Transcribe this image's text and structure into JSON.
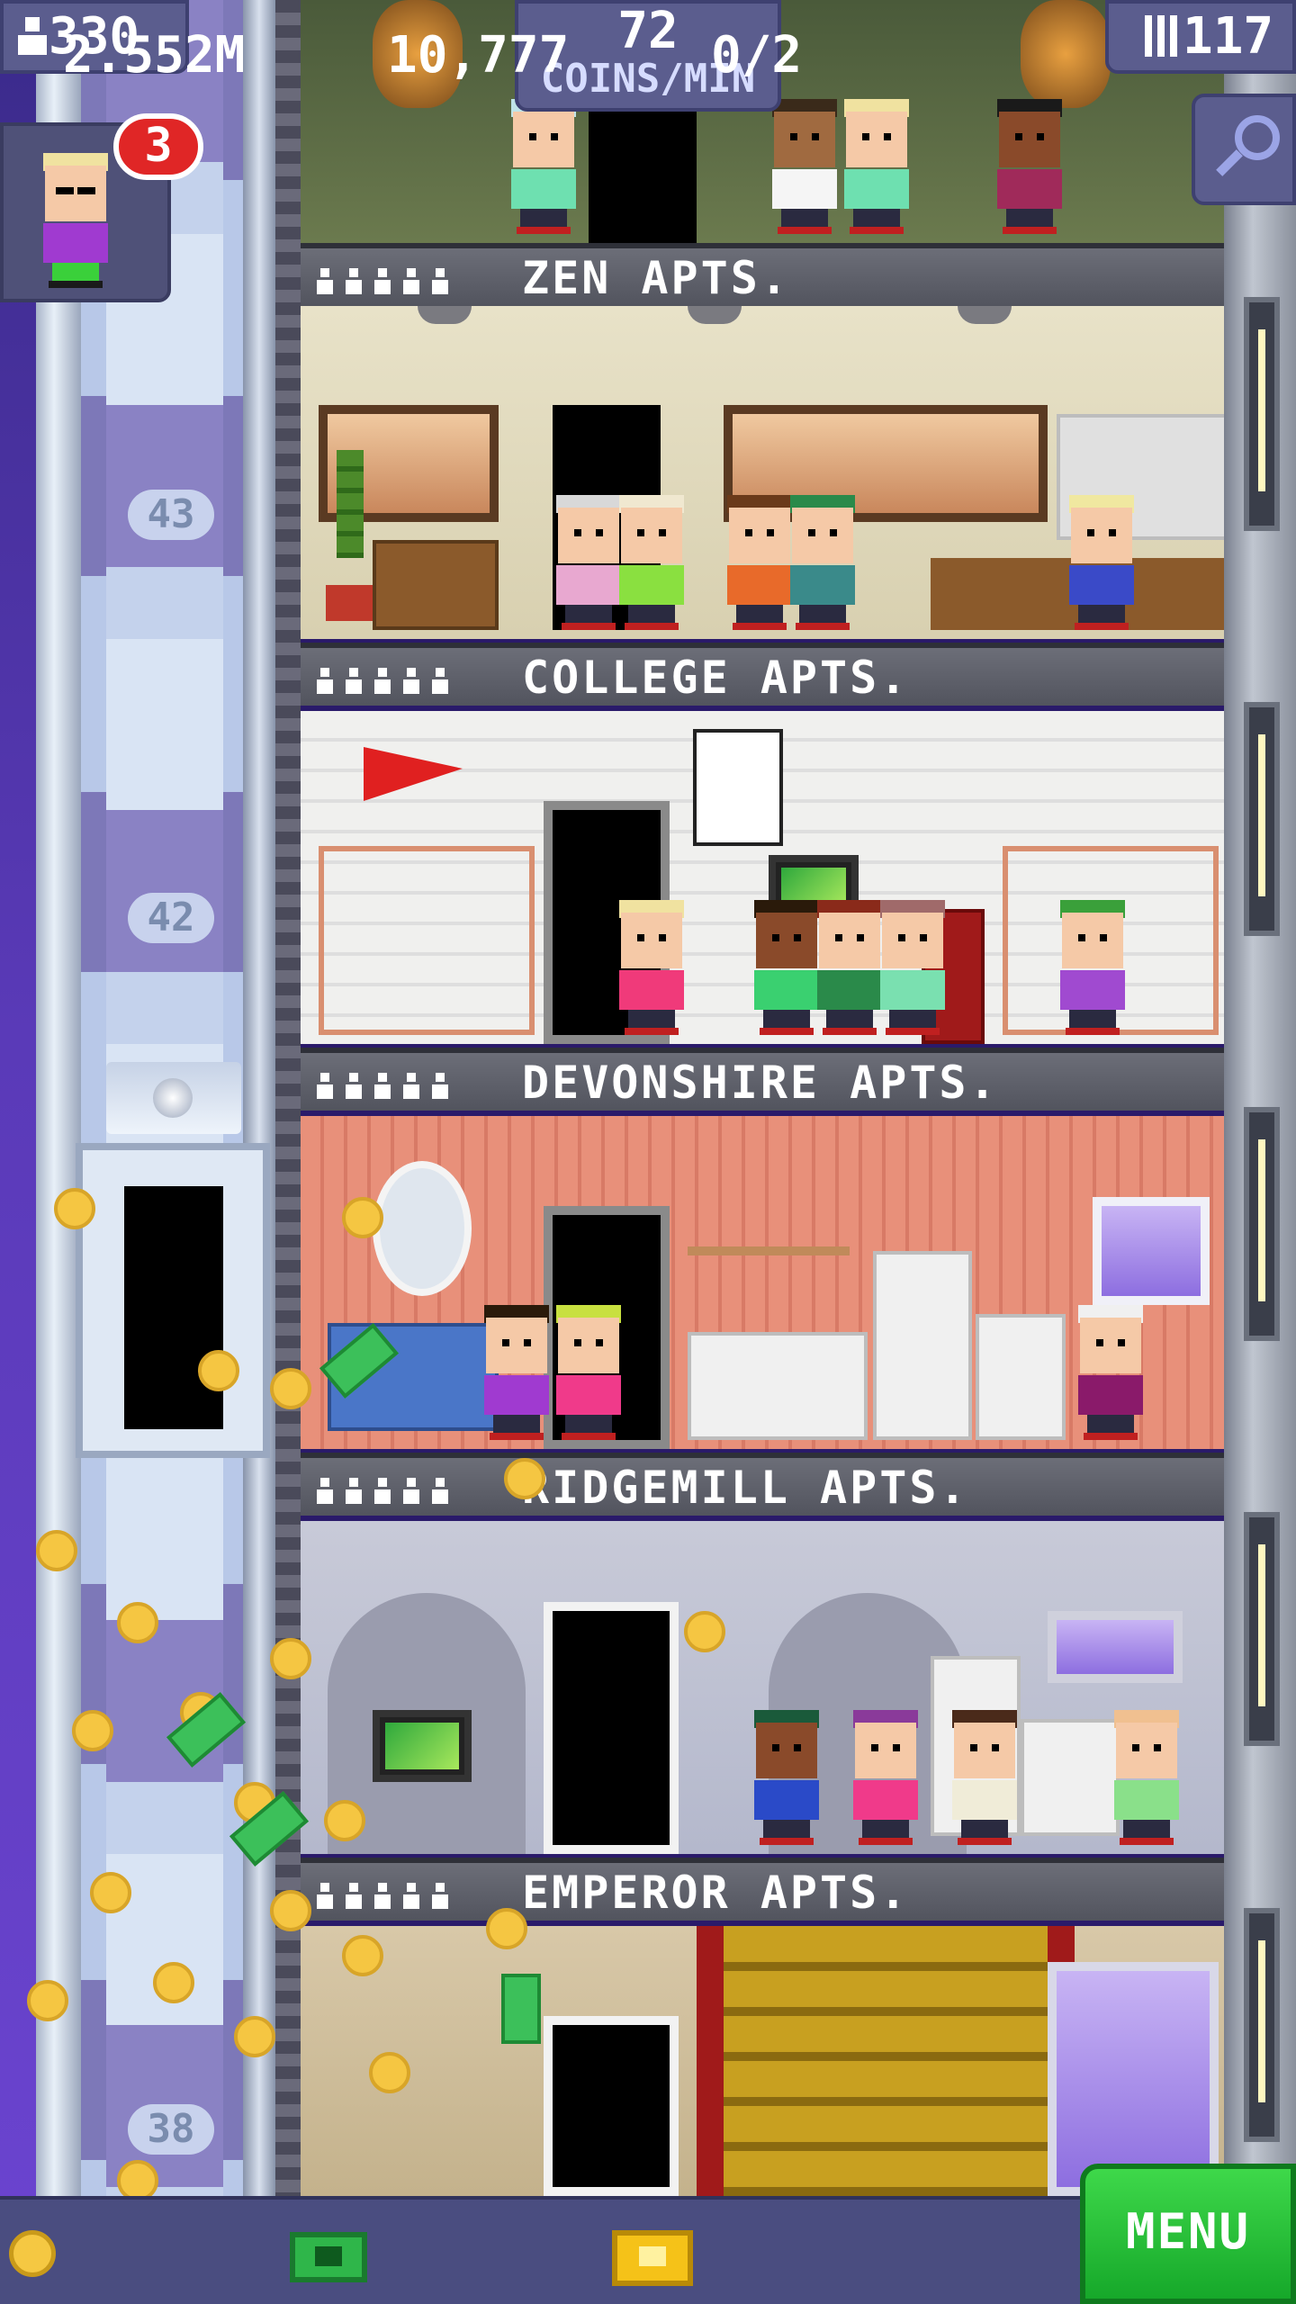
{
  "hud": {
    "population": "330",
    "coins_per_min_value": "72",
    "coins_per_min_unit": "COINS/MIN",
    "floors": "117",
    "visitor_badge": "3"
  },
  "shaft_floor_numbers": [
    "43",
    "42",
    "38"
  ],
  "floors": [
    {
      "name": "ZEN APTS.",
      "residents": 5
    },
    {
      "name": "COLLEGE APTS.",
      "residents": 5
    },
    {
      "name": "DEVONSHIRE APTS.",
      "residents": 5
    },
    {
      "name": "RIDGEMILL APTS.",
      "residents": 5
    },
    {
      "name": "EMPEROR APTS.",
      "residents": 5
    }
  ],
  "bottom_bar": {
    "coins": "2.552M",
    "bux": "10,777",
    "vip": "0/2",
    "menu_label": "MENU"
  },
  "icons": [
    "population-icon",
    "floors-icon",
    "search-icon",
    "coin-icon",
    "bux-icon",
    "vip-ticket-icon",
    "resident-icon"
  ],
  "colors": {
    "hud_panel": "#5b5d8e",
    "menu_green": "#2fc23c",
    "badge_red": "#e02626",
    "coin_gold": "#f5c642",
    "bux_green": "#2fb64a"
  }
}
